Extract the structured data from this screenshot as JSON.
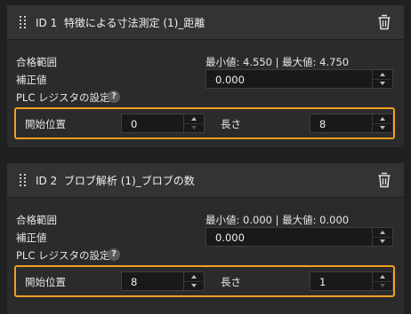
{
  "panels": [
    {
      "id_label": "ID 1",
      "title": "特徴による寸法測定 (1)_距離",
      "pass_range_label": "合格範囲",
      "pass_range_value": "最小値: 4.550 | 最大値: 4.750",
      "correction_label": "補正値",
      "correction_value": "0.000",
      "plc_label": "PLC レジスタの設定",
      "help_glyph": "?",
      "start_label": "開始位置",
      "start_value": "0",
      "length_label": "長さ",
      "length_value": "8"
    },
    {
      "id_label": "ID 2",
      "title": "ブロブ解析 (1)_ブロブの数",
      "pass_range_label": "合格範囲",
      "pass_range_value": "最小値: 0.000 | 最大値: 0.000",
      "correction_label": "補正値",
      "correction_value": "0.000",
      "plc_label": "PLC レジスタの設定",
      "help_glyph": "?",
      "start_label": "開始位置",
      "start_value": "8",
      "length_label": "長さ",
      "length_value": "1"
    }
  ],
  "colors": {
    "highlight_border": "#f0a020",
    "panel_bg": "#2b2b2b",
    "header_bg": "#333333",
    "input_bg": "#191919"
  },
  "icons": [
    "drag-handle-icon",
    "trash-icon",
    "help-icon",
    "spin-up-icon",
    "spin-down-icon"
  ]
}
